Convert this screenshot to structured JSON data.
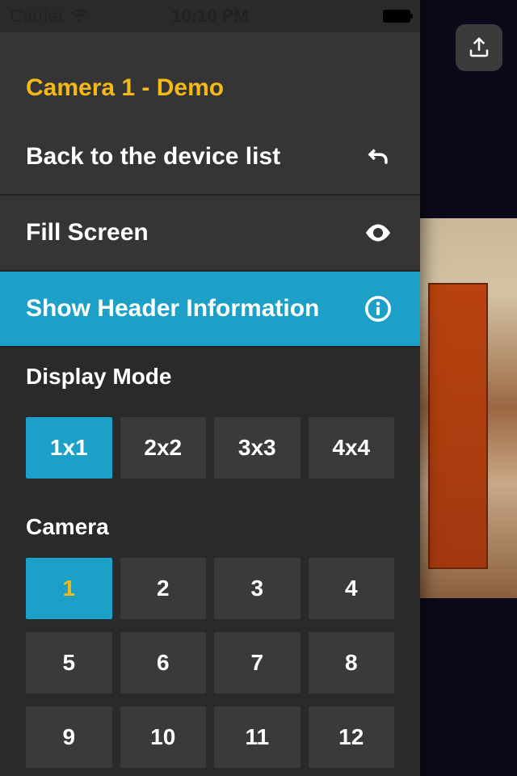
{
  "status": {
    "carrier": "Carrier",
    "time": "10:10 PM"
  },
  "title": "Camera 1 - Demo",
  "menu": {
    "back": "Back to the device list",
    "fill": "Fill Screen",
    "header_info": "Show Header Information",
    "display_mode_label": "Display Mode",
    "camera_label": "Camera"
  },
  "display_modes": [
    "1x1",
    "2x2",
    "3x3",
    "4x4"
  ],
  "display_mode_selected": "1x1",
  "cameras": [
    "1",
    "2",
    "3",
    "4",
    "5",
    "6",
    "7",
    "8",
    "9",
    "10",
    "11",
    "12"
  ],
  "camera_selected": "1"
}
